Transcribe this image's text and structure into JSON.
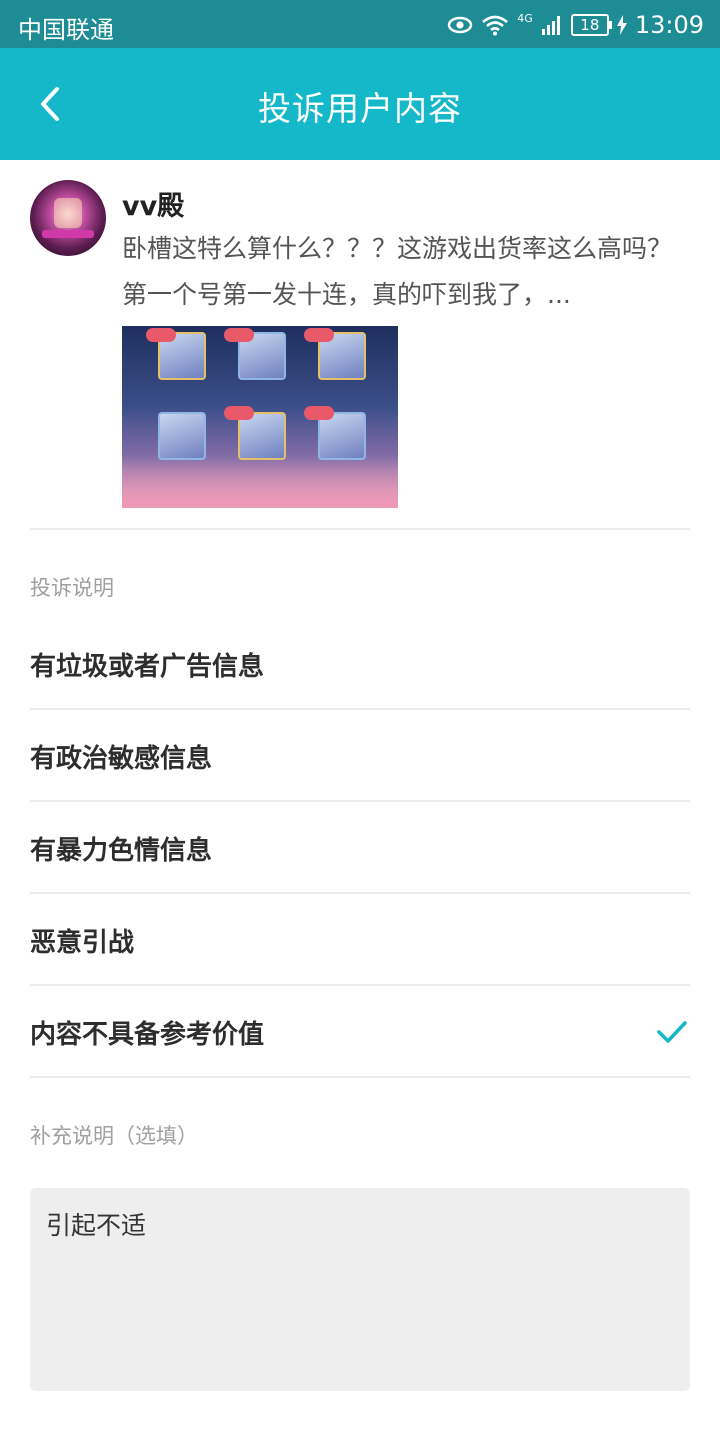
{
  "status_bar": {
    "carrier": "中国联通",
    "network": "4G",
    "battery": "18",
    "time": "13:09"
  },
  "header": {
    "title": "投诉用户内容",
    "back_icon": "chevron-left-icon"
  },
  "post": {
    "username": "vv殿",
    "text": "卧槽这特么算什么？？？这游戏出货率这么高吗？第一个号第一发十连，真的吓到我了，..."
  },
  "complaint": {
    "section_label": "投诉说明",
    "options": [
      {
        "label": "有垃圾或者广告信息",
        "selected": false
      },
      {
        "label": "有政治敏感信息",
        "selected": false
      },
      {
        "label": "有暴力色情信息",
        "selected": false
      },
      {
        "label": "恶意引战",
        "selected": false
      },
      {
        "label": "内容不具备参考价值",
        "selected": true
      }
    ],
    "check_icon": "checkmark-icon"
  },
  "supplement": {
    "label": "补充说明（选填）",
    "value": "引起不适"
  },
  "colors": {
    "status_bar": "#1d8c95",
    "app_bar": "#14b8c8",
    "accent_check": "#14b8c8",
    "textarea_bg": "#eeeeee"
  }
}
